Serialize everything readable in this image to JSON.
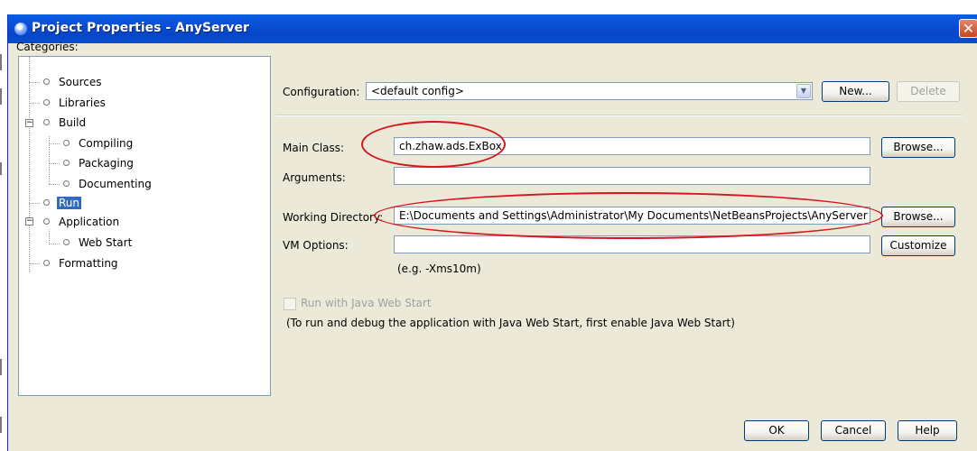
{
  "window": {
    "title": "Project Properties - AnyServer",
    "close_glyph": "✕"
  },
  "categories": {
    "label": "Categories:",
    "items": [
      {
        "label": "Sources"
      },
      {
        "label": "Libraries"
      },
      {
        "label": "Build"
      },
      {
        "label": "Compiling"
      },
      {
        "label": "Packaging"
      },
      {
        "label": "Documenting"
      },
      {
        "label": "Run"
      },
      {
        "label": "Application"
      },
      {
        "label": "Web Start"
      },
      {
        "label": "Formatting"
      }
    ],
    "selected": "Run"
  },
  "configuration": {
    "label": "Configuration:",
    "value": "<default config>",
    "new_label": "New...",
    "delete_label": "Delete"
  },
  "main_class": {
    "label": "Main Class:",
    "value": "ch.zhaw.ads.ExBox",
    "browse_label": "Browse..."
  },
  "arguments": {
    "label": "Arguments:",
    "value": ""
  },
  "working_directory": {
    "label": "Working Directory:",
    "value": "E:\\Documents and Settings\\Administrator\\My Documents\\NetBeansProjects\\AnyServer",
    "browse_label": "Browse..."
  },
  "vm_options": {
    "label": "VM Options:",
    "value": "",
    "customize_label": "Customize",
    "hint": "(e.g. -Xms10m)"
  },
  "web_start": {
    "checkbox_label": "Run with Java Web Start",
    "checked": false,
    "note": "(To run and debug the application with Java Web Start, first enable Java Web Start)"
  },
  "footer": {
    "ok_label": "OK",
    "cancel_label": "Cancel",
    "help_label": "Help"
  },
  "colors": {
    "annotation": "#d4161e",
    "selection": "#316ac5",
    "titlebar": "#0a51d8"
  }
}
